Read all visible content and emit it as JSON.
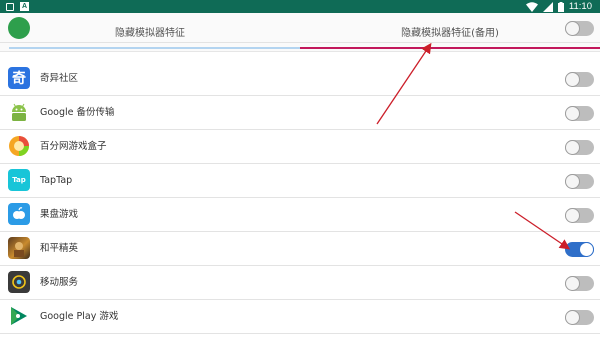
{
  "status_bar": {
    "time": "11:10",
    "icons": [
      "square-icon",
      "a-badge-icon",
      "wifi-icon",
      "signal-icon",
      "battery-icon"
    ]
  },
  "tabs": [
    {
      "label": "隐藏模拟器特征",
      "selected": false
    },
    {
      "label": "隐藏模拟器特征(备用)",
      "selected": true
    }
  ],
  "apps": [
    {
      "name": "",
      "icon": "green-app-icon",
      "enabled": false,
      "partial": true
    },
    {
      "name": "奇异社区",
      "icon": "qiyi-community-icon",
      "enabled": false
    },
    {
      "name": "Google 备份传输",
      "icon": "android-robot-icon",
      "enabled": false
    },
    {
      "name": "百分网游戏盒子",
      "icon": "baifen-game-box-icon",
      "enabled": false
    },
    {
      "name": "TapTap",
      "icon": "taptap-icon",
      "enabled": false,
      "icon_text": "Tap"
    },
    {
      "name": "果盘游戏",
      "icon": "guopan-game-icon",
      "enabled": false
    },
    {
      "name": "和平精英",
      "icon": "peacekeeper-elite-icon",
      "enabled": true
    },
    {
      "name": "移动服务",
      "icon": "mobile-service-icon",
      "enabled": false
    },
    {
      "name": "Google Play 游戏",
      "icon": "google-play-games-icon",
      "enabled": false
    }
  ],
  "colors": {
    "status_bar": "#0f6b56",
    "tab_indicator": "#c2185b",
    "switch_on": "#2f6fc9",
    "annotation_arrow": "#cc1f2a"
  }
}
